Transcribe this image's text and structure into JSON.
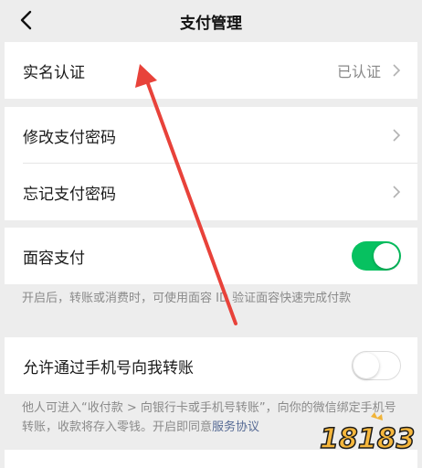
{
  "header": {
    "title": "支付管理",
    "back_icon": "chevron-left-icon"
  },
  "verify": {
    "label": "实名认证",
    "value": "已认证"
  },
  "password": {
    "change_label": "修改支付密码",
    "forgot_label": "忘记支付密码"
  },
  "face_pay": {
    "label": "面容支付",
    "enabled": true,
    "note": "开启后，转账或消费时，可使用面容 ID 验证面容快速完成付款"
  },
  "phone_transfer": {
    "label": "允许通过手机号向我转账",
    "enabled": false,
    "note": "他人可进入“收付款 > 向银行卡或手机号转账”，向你的微信绑定手机号转账，收款将存入零钱。开启即同意",
    "note_link": "服务协议"
  },
  "watermark": {
    "text": "18183"
  },
  "colors": {
    "toggle_on": "#07c160",
    "link": "#576b95",
    "annotation_arrow": "#e8423a"
  }
}
